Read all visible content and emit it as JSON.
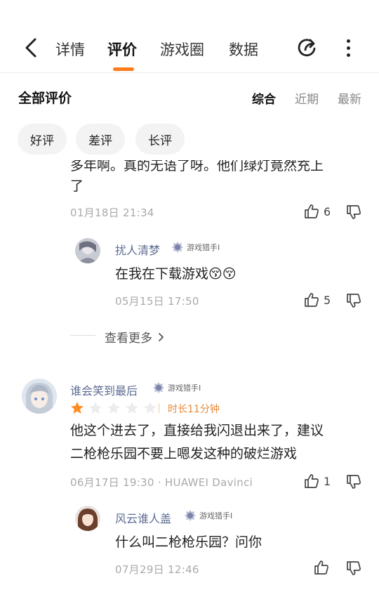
{
  "nav": {
    "tabs": [
      "详情",
      "评价",
      "游戏圈",
      "数据"
    ],
    "active_tab": 1,
    "accent_color": "#ff7a1a"
  },
  "section": {
    "title": "全部评价",
    "sort_options": [
      "综合",
      "近期",
      "最新"
    ],
    "active_sort": 0
  },
  "filters": [
    "好评",
    "差评",
    "长评"
  ],
  "comment1": {
    "text_line1": "多年啊。真的无语了呀。他们绿灯竟然充上",
    "text_line2": "了",
    "date": "01月18日 21:34",
    "likes": "6",
    "reply": {
      "name": "扰人清梦",
      "badge": "游戏猎手I",
      "text": "在我在下载游戏😚😚",
      "date": "05月15日 17:50",
      "likes": "5"
    },
    "see_more": "查看更多"
  },
  "comment2": {
    "name": "谁会笑到最后",
    "badge": "游戏猎手I",
    "rating": 1,
    "max_rating": 5,
    "duration": "时长11分钟",
    "text_line1": "他这个进去了，直接给我闪退出来了，建议",
    "text_line2": "二枪枪乐园不要上嗯发这种的破烂游戏",
    "meta": "06月17日 19:30 · HUAWEI Davinci",
    "likes": "1",
    "reply": {
      "name": "风云谁人盖",
      "badge": "游戏猎手I",
      "text": "什么叫二枪枪乐园？问你",
      "date": "07月29日 12:46"
    }
  }
}
